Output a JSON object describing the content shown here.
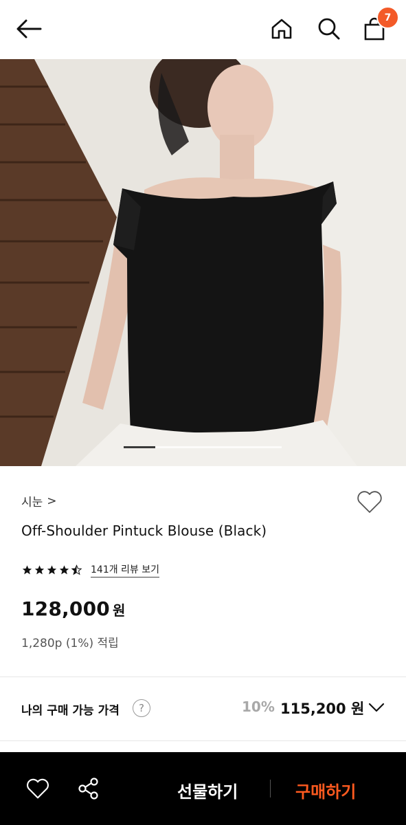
{
  "header": {
    "cart_count": "7",
    "accent_color": "#f35a28"
  },
  "gallery": {
    "current_index": 1,
    "total": 5
  },
  "product": {
    "brand": "시눈",
    "brand_arrow": ">",
    "name": "Off-Shoulder Pintuck Blouse (Black)",
    "rating": 4.5,
    "review_link": "141개 리뷰 보기",
    "price": "128,000",
    "price_unit": "원",
    "points": "1,280p (1%) 적립"
  },
  "my_price": {
    "label": "나의 구매 가능 가격",
    "help": "?",
    "discount": "10%",
    "price": "115,200 원"
  },
  "bottom_bar": {
    "gift_label": "선물하기",
    "buy_label": "구매하기",
    "buy_color": "#ff5a1f"
  }
}
